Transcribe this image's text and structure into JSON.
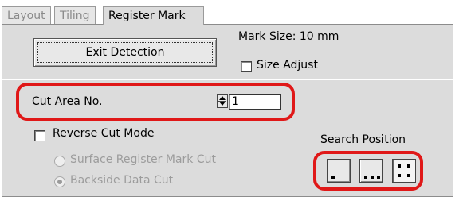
{
  "tabs": [
    {
      "label": "Layout",
      "active": false
    },
    {
      "label": "Tiling",
      "active": false
    },
    {
      "label": "Register Mark",
      "active": true
    }
  ],
  "exit_detection_label": "Exit Detection",
  "mark_size_text": "Mark Size: 10 mm",
  "size_adjust_label": "Size Adjust",
  "size_adjust_checked": false,
  "cut_area": {
    "label": "Cut Area No.",
    "value": "1"
  },
  "reverse_cut_mode_label": "Reverse Cut Mode",
  "reverse_cut_mode_checked": false,
  "radio_options": [
    {
      "label": "Surface Register Mark Cut",
      "checked": false,
      "enabled": false
    },
    {
      "label": "Backside Data Cut",
      "checked": true,
      "enabled": false
    }
  ],
  "search_position": {
    "label": "Search Position",
    "options": [
      {
        "name": "one-dot",
        "selected": false
      },
      {
        "name": "two-dots",
        "selected": false
      },
      {
        "name": "four-dots",
        "selected": true
      }
    ]
  },
  "highlight_color": "#e01818"
}
